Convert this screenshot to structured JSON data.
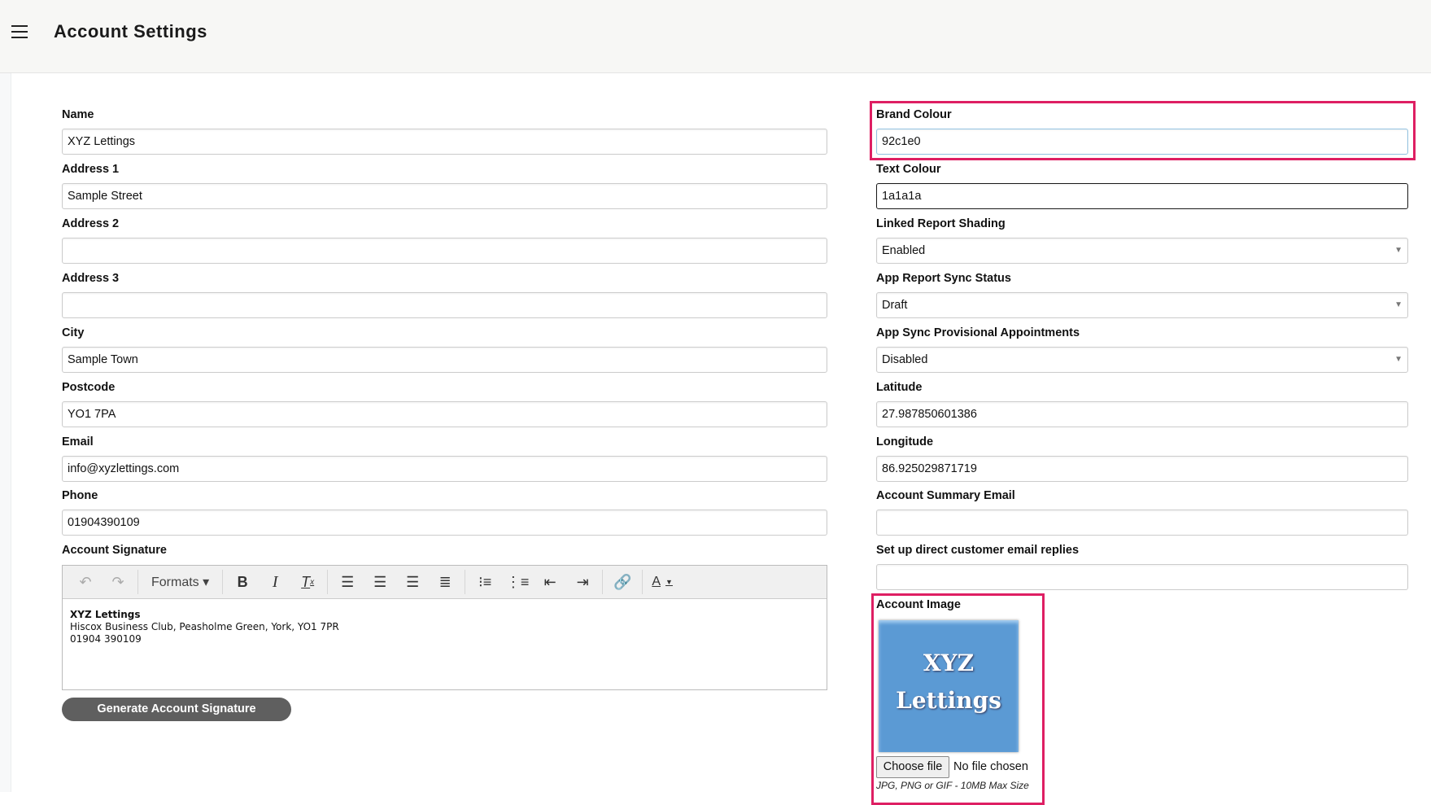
{
  "header": {
    "title": "Account Settings"
  },
  "left": [
    {
      "label": "Name",
      "value": "XYZ Lettings"
    },
    {
      "label": "Address 1",
      "value": "Sample Street"
    },
    {
      "label": "Address 2",
      "value": ""
    },
    {
      "label": "Address 3",
      "value": ""
    },
    {
      "label": "City",
      "value": "Sample Town"
    },
    {
      "label": "Postcode",
      "value": "YO1 7PA"
    },
    {
      "label": "Email",
      "value": "info@xyzlettings.com"
    },
    {
      "label": "Phone",
      "value": "01904390109"
    }
  ],
  "signature": {
    "label": "Account Signature",
    "formats": "Formats",
    "name": "XYZ Lettings",
    "address": "Hiscox Business Club, Peasholme Green, York, YO1 7PR",
    "phone": "01904 390109",
    "button": "Generate Account Signature"
  },
  "right": [
    {
      "label": "Brand Colour",
      "value": "92c1e0"
    },
    {
      "label": "Text Colour",
      "value": "1a1a1a"
    },
    {
      "label": "Linked Report Shading",
      "value": "Enabled"
    },
    {
      "label": "App Report Sync Status",
      "value": "Draft"
    },
    {
      "label": "App Sync Provisional Appointments",
      "value": "Disabled"
    },
    {
      "label": "Latitude",
      "value": "27.987850601386"
    },
    {
      "label": "Longitude",
      "value": "86.925029871719"
    },
    {
      "label": "Account Summary Email",
      "value": ""
    },
    {
      "label": "Set up direct customer email replies",
      "value": ""
    }
  ],
  "image": {
    "label": "Account Image",
    "logo_text": "XYZ Lettings",
    "choose": "Choose file",
    "nofile": "No file chosen",
    "hint": "JPG, PNG or GIF - 10MB Max Size"
  },
  "colors": {
    "brand": "#92c1e0",
    "text": "#1a1a1a",
    "highlight": "#de1f63"
  }
}
